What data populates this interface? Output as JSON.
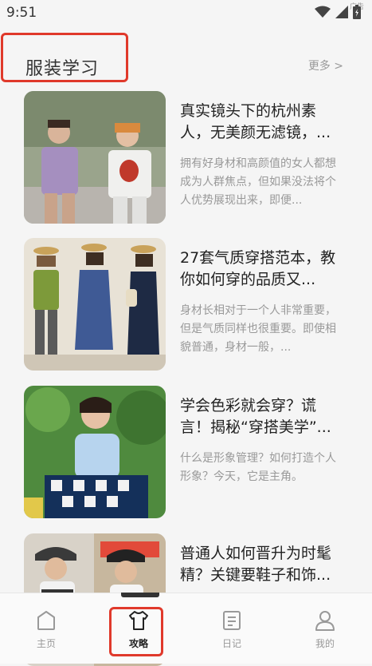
{
  "status_bar": {
    "time": "9:51",
    "ad_label": "广告"
  },
  "section": {
    "title": "服装学习",
    "more_label": "更多 >"
  },
  "articles": [
    {
      "title": "真实镜头下的杭州素人，无美颜无滤镜，...",
      "desc": "拥有好身材和高颜值的女人都想成为人群焦点，但如果没法将个人优势展现出来，即便...",
      "image": "two-women-street-photo"
    },
    {
      "title": "27套气质穿搭范本，教你如何穿的品质又...",
      "desc": "身材长相对于一个人非常重要，但是气质同样也很重要。即使相貌普通，身材一般，...",
      "image": "three-outfits-mirror-photo"
    },
    {
      "title": "学会色彩就会穿？谎言！揭秘“穿搭美学”...",
      "desc": "什么是形象管理？如何打造个人形象？今天，它是主角。",
      "image": "woman-blue-tee-garden-photo"
    },
    {
      "title": "普通人如何晋升为时髦精？关键要鞋子和饰...",
      "desc": "",
      "image": "women-in-caps-photo"
    }
  ],
  "tabs": [
    {
      "label": "主页",
      "icon": "home-icon"
    },
    {
      "label": "攻略",
      "icon": "tshirt-icon"
    },
    {
      "label": "日记",
      "icon": "notes-icon"
    },
    {
      "label": "我的",
      "icon": "user-icon"
    }
  ],
  "colors": {
    "accent_highlight": "#e0392b",
    "muted_text": "#999999"
  }
}
